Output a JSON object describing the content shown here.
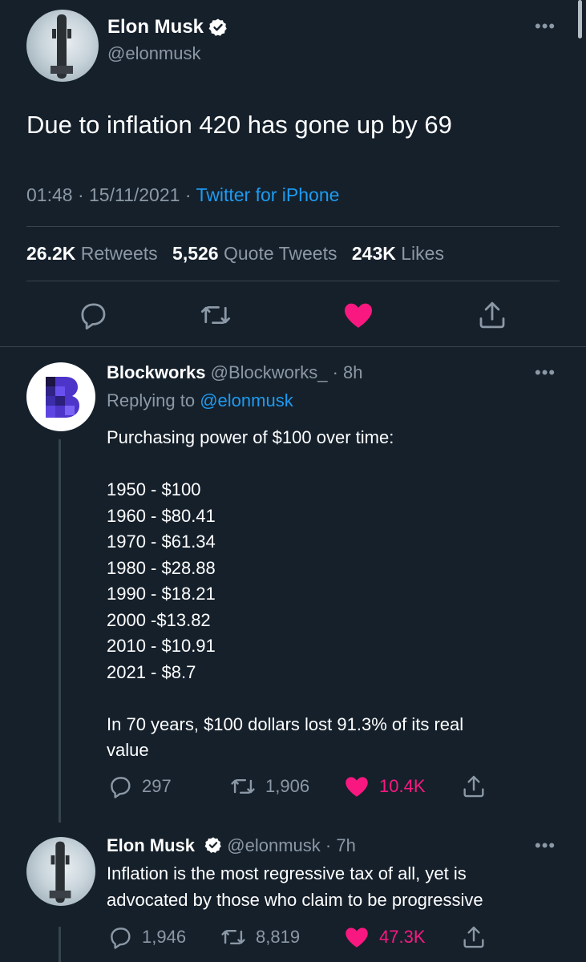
{
  "main_tweet": {
    "author_name": "Elon Musk",
    "author_handle": "@elonmusk",
    "text": "Due to inflation 420 has gone up by 69",
    "time": "01:48",
    "date": "15/11/2021",
    "source": "Twitter for iPhone",
    "retweets_count": "26.2K",
    "retweets_label": "Retweets",
    "quotes_count": "5,526",
    "quotes_label": "Quote Tweets",
    "likes_count": "243K",
    "likes_label": "Likes",
    "liked": true
  },
  "replies": [
    {
      "author_name": "Blockworks",
      "author_handle": "@Blockworks_",
      "age": "8h",
      "replying_to_label": "Replying to",
      "replying_to_handle": "@elonmusk",
      "lines": [
        "Purchasing power of $100 over time:",
        "",
        "1950 - $100",
        "1960 - $80.41",
        "1970 - $61.34",
        "1980 - $28.88",
        "1990 - $18.21",
        "2000 -$13.82",
        "2010 - $10.91",
        "2021 - $8.7",
        "",
        "In 70 years, $100 dollars lost 91.3% of its real",
        "value"
      ],
      "replies_count": "297",
      "retweets_count": "1,906",
      "likes_count": "10.4K",
      "liked": true
    },
    {
      "author_name": "Elon Musk",
      "author_handle": "@elonmusk",
      "age": "7h",
      "lines": [
        "Inflation is the most regressive tax of all, yet is",
        "advocated by those who claim to be progressive"
      ],
      "replies_count": "1,946",
      "retweets_count": "8,819",
      "likes_count": "47.3K",
      "liked": true
    }
  ],
  "colors": {
    "background": "#15202b",
    "accent": "#1d9bf0",
    "like": "#f91880",
    "muted": "#8b98a5",
    "brand_blockworks": "#5b3fd6"
  }
}
